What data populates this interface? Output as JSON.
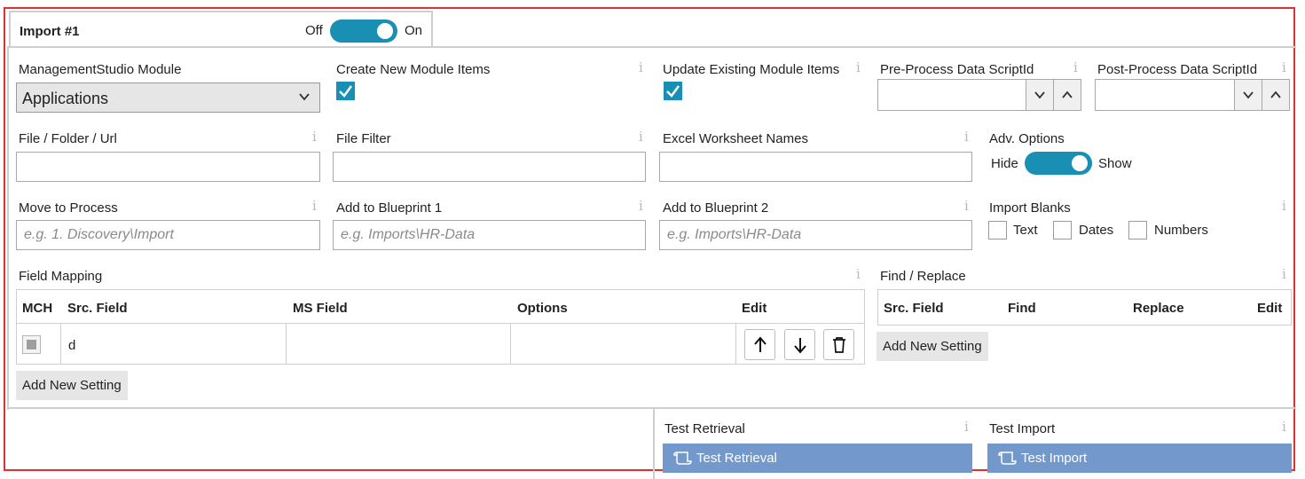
{
  "tab": {
    "title": "Import #1",
    "toggle_off": "Off",
    "toggle_on": "On"
  },
  "row1": {
    "module_label": "ManagementStudio Module",
    "module_value": "Applications",
    "create_label": "Create New Module Items",
    "update_label": "Update Existing Module Items",
    "pre_label": "Pre-Process Data ScriptId",
    "post_label": "Post-Process Data ScriptId"
  },
  "row2": {
    "file_label": "File / Folder / Url",
    "filter_label": "File Filter",
    "excel_label": "Excel Worksheet Names",
    "adv_label": "Adv. Options",
    "adv_hide": "Hide",
    "adv_show": "Show"
  },
  "row3": {
    "move_label": "Move to Process",
    "move_placeholder": "e.g. 1. Discovery\\Import",
    "bp1_label": "Add to Blueprint 1",
    "bp1_placeholder": "e.g. Imports\\HR-Data",
    "bp2_label": "Add to Blueprint 2",
    "bp2_placeholder": "e.g. Imports\\HR-Data",
    "blanks_label": "Import Blanks",
    "blank_text": "Text",
    "blank_dates": "Dates",
    "blank_numbers": "Numbers"
  },
  "mapping": {
    "label": "Field Mapping",
    "headers": {
      "mch": "MCH",
      "src": "Src. Field",
      "ms": "MS Field",
      "options": "Options",
      "edit": "Edit"
    },
    "rows": [
      {
        "src": "d",
        "ms": "",
        "options": ""
      }
    ],
    "add_button": "Add New Setting"
  },
  "find_replace": {
    "label": "Find / Replace",
    "headers": {
      "src": "Src. Field",
      "find": "Find",
      "replace": "Replace",
      "edit": "Edit"
    },
    "add_button": "Add New Setting"
  },
  "tests": {
    "retrieval_label": "Test Retrieval",
    "retrieval_button": "Test Retrieval",
    "import_label": "Test Import",
    "import_button": "Test Import"
  },
  "info_glyph": "i",
  "colors": {
    "accent": "#1a8fb4",
    "button_blue": "#7399cc",
    "frame_red": "#e03030"
  }
}
